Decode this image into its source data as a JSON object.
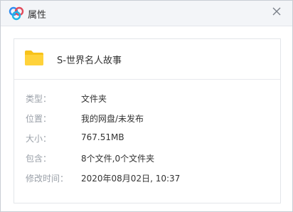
{
  "window": {
    "title": "属性",
    "app_icon": "baidu-netdisk-icon",
    "close_icon": "close-icon"
  },
  "file": {
    "icon": "folder-icon",
    "icon_color": "#f7c21a",
    "name": "S-世界名人故事"
  },
  "properties": [
    {
      "label": "类型：",
      "value": "文件夹"
    },
    {
      "label": "位置：",
      "value": "我的网盘/未发布"
    },
    {
      "label": "大小：",
      "value": "767.51MB"
    },
    {
      "label": "包含：",
      "value": "8个文件,0个文件夹"
    },
    {
      "label": "修改时间：",
      "value": "2020年08月02日, 10:37"
    }
  ]
}
